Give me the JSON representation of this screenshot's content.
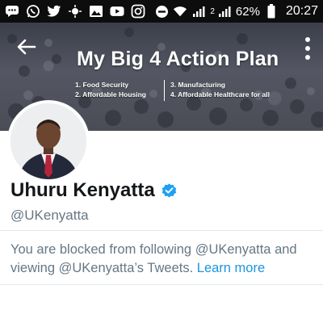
{
  "status_bar": {
    "battery": "62%",
    "time": "20:27",
    "signal_label": "2"
  },
  "header": {
    "title": "My Big 4 Action Plan",
    "pillars": [
      "1. Food Security",
      "2. Affordable Housing",
      "3. Manufacturing",
      "4. Affordable Healthcare for all"
    ]
  },
  "profile": {
    "name": "Uhuru Kenyatta",
    "handle": "@UKenyatta",
    "verified": true
  },
  "blocked_notice": {
    "text": "You are blocked from following @UKenyatta and viewing @UKenyatta’s Tweets.",
    "link": "Learn more"
  },
  "colors": {
    "accent": "#1b95e0",
    "verified_badge": "#1da1f2",
    "secondary_text": "#657786"
  }
}
